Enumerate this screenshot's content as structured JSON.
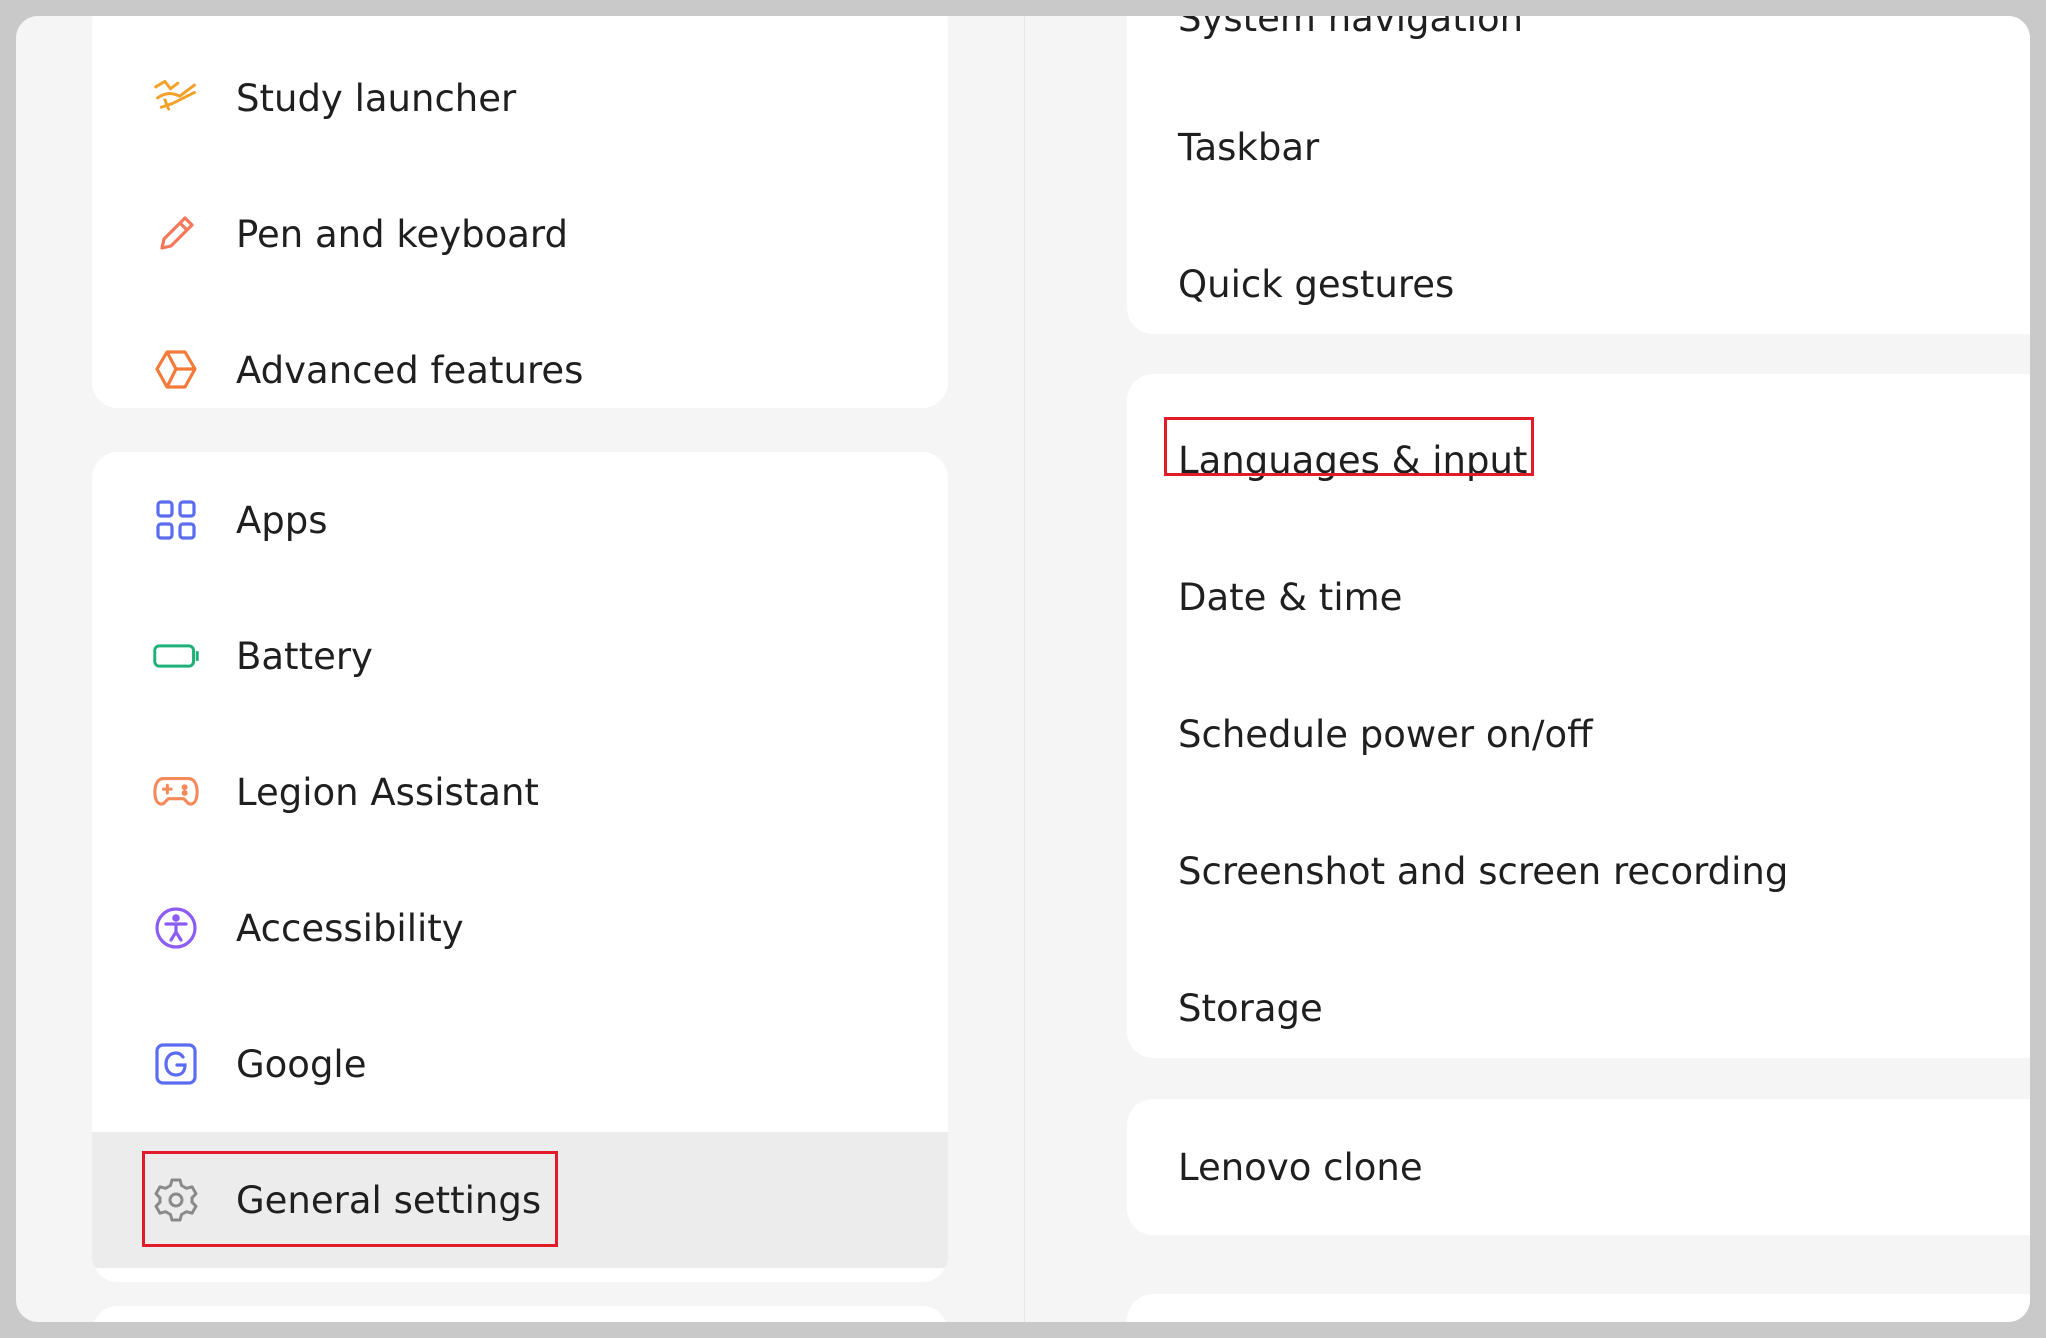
{
  "sidebar": {
    "group1": [
      {
        "label": "Study launcher",
        "icon": "study-launcher-icon",
        "color": "#f4a12b"
      },
      {
        "label": "Pen and keyboard",
        "icon": "pen-icon",
        "color": "#f4785a"
      },
      {
        "label": "Advanced features",
        "icon": "cube-icon",
        "color": "#f47a3a"
      }
    ],
    "group2": [
      {
        "label": "Apps",
        "icon": "apps-grid-icon",
        "color": "#5b6cf0"
      },
      {
        "label": "Battery",
        "icon": "battery-icon",
        "color": "#1fb07a"
      },
      {
        "label": "Legion Assistant",
        "icon": "gamepad-icon",
        "color": "#f4895a"
      },
      {
        "label": "Accessibility",
        "icon": "accessibility-icon",
        "color": "#8b5cf6"
      },
      {
        "label": "Google",
        "icon": "google-icon",
        "color": "#5b6cf0"
      },
      {
        "label": "General settings",
        "icon": "gear-icon",
        "color": "#8a8a8a",
        "selected": true
      }
    ]
  },
  "main": {
    "partial_top": "System navigation",
    "group1": [
      {
        "label": "Taskbar"
      },
      {
        "label": "Quick gestures"
      }
    ],
    "group2": [
      {
        "label": "Languages & input"
      },
      {
        "label": "Date & time"
      },
      {
        "label": "Schedule power on/off"
      },
      {
        "label": "Screenshot and screen recording"
      },
      {
        "label": "Storage"
      }
    ],
    "group3": [
      {
        "label": "Lenovo clone"
      }
    ]
  },
  "colors": {
    "highlight": "#e21b2a",
    "selected_bg": "#ececec"
  }
}
